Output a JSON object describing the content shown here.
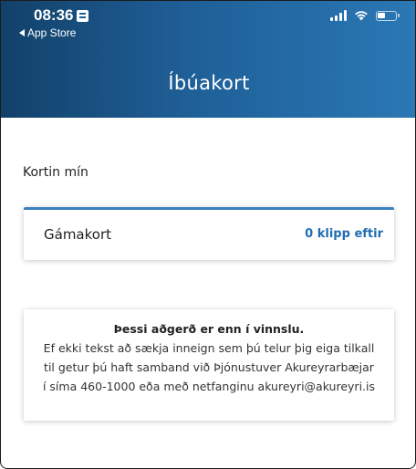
{
  "status_bar": {
    "time": "08:36",
    "back_label": "App Store"
  },
  "header": {
    "title": "Íbúakort"
  },
  "section": {
    "label": "Kortin mín"
  },
  "card": {
    "name": "Gámakort",
    "count_label": "0 klipp eftir"
  },
  "notice": {
    "title": "Þessi aðgerð er enn í vinnslu.",
    "lines": [
      "Ef ekki tekst að sækja inneign sem þú telur þig eiga tilkall",
      "til getur þú haft samband við Þjónustuver Akureyrarbæjar",
      "í síma 460-1000 eða með netfanginu akureyri@akureyri.is"
    ]
  },
  "colors": {
    "header_start": "#12416a",
    "header_end": "#2a78b5",
    "accent": "#1f6db3"
  },
  "icons": {
    "status_id": "id-card-icon",
    "back": "back-triangle-icon",
    "signal": "cell-signal-icon",
    "wifi": "wifi-icon",
    "battery": "battery-icon"
  }
}
